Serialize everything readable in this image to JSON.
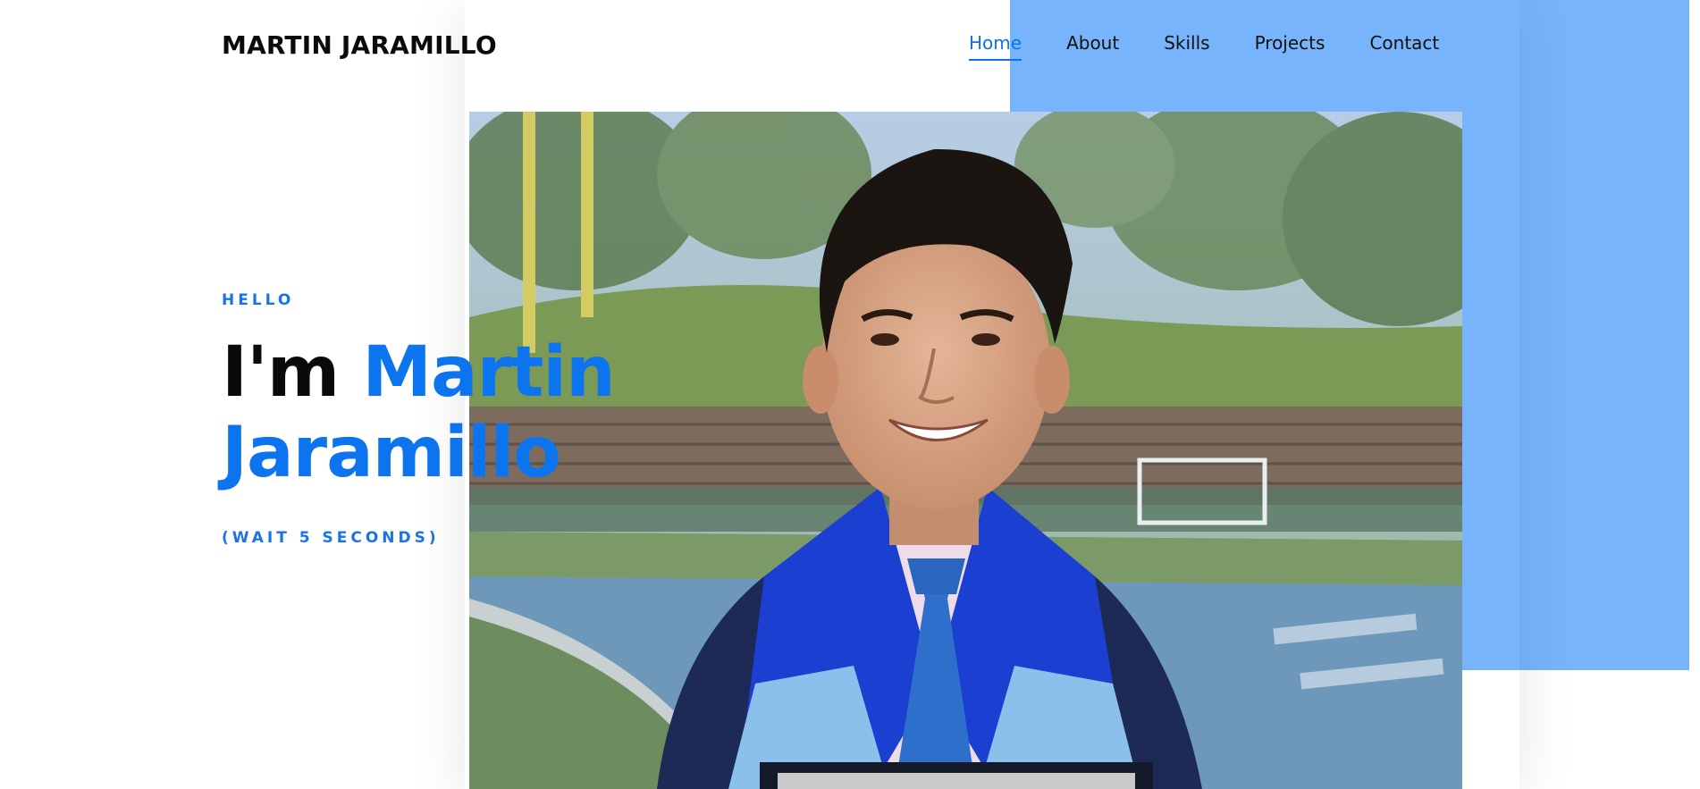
{
  "header": {
    "logo": "MARTIN JARAMILLO",
    "nav": [
      {
        "label": "Home",
        "active": true
      },
      {
        "label": "About"
      },
      {
        "label": "Skills"
      },
      {
        "label": "Projects"
      },
      {
        "label": "Contact"
      }
    ]
  },
  "hero": {
    "greeting": "HELLO",
    "headline_prefix": "I'm ",
    "first_name": "Martin",
    "last_name": "Jaramillo",
    "hint": "(WAIT 5 SECONDS)"
  },
  "colors": {
    "accent": "#0d74f0",
    "accent_block": "#78b4fb",
    "text": "#0a0a0a"
  }
}
